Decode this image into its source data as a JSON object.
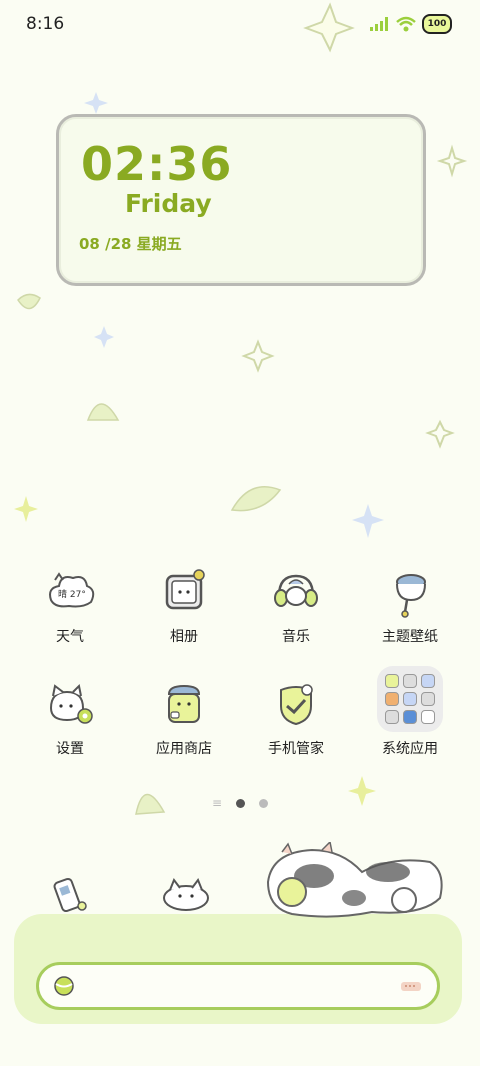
{
  "status_bar": {
    "time": "8:16",
    "battery": "100"
  },
  "clock_widget": {
    "time": "02:36",
    "day": "Friday",
    "date": "08 /28  星期五"
  },
  "apps_row1": [
    {
      "label": "天气",
      "icon": "weather-cloud-icon",
      "badge": "晴 27°"
    },
    {
      "label": "相册",
      "icon": "gallery-cat-icon"
    },
    {
      "label": "音乐",
      "icon": "music-headphones-icon"
    },
    {
      "label": "主题壁纸",
      "icon": "theme-paint-icon"
    }
  ],
  "apps_row2": [
    {
      "label": "设置",
      "icon": "settings-cat-icon"
    },
    {
      "label": "应用商店",
      "icon": "app-store-bag-icon"
    },
    {
      "label": "手机管家",
      "icon": "security-shield-icon"
    },
    {
      "label": "系统应用",
      "icon": "system-apps-folder-icon"
    }
  ],
  "page_indicator": {
    "pages": 2,
    "active": 0
  },
  "dock": [
    {
      "icon": "phone-handset-icon"
    },
    {
      "icon": "messages-cat-icon"
    }
  ],
  "colors": {
    "accent": "#8aaa22",
    "dock_bg": "#e9f6c8",
    "search_border": "#a7cd5d"
  }
}
